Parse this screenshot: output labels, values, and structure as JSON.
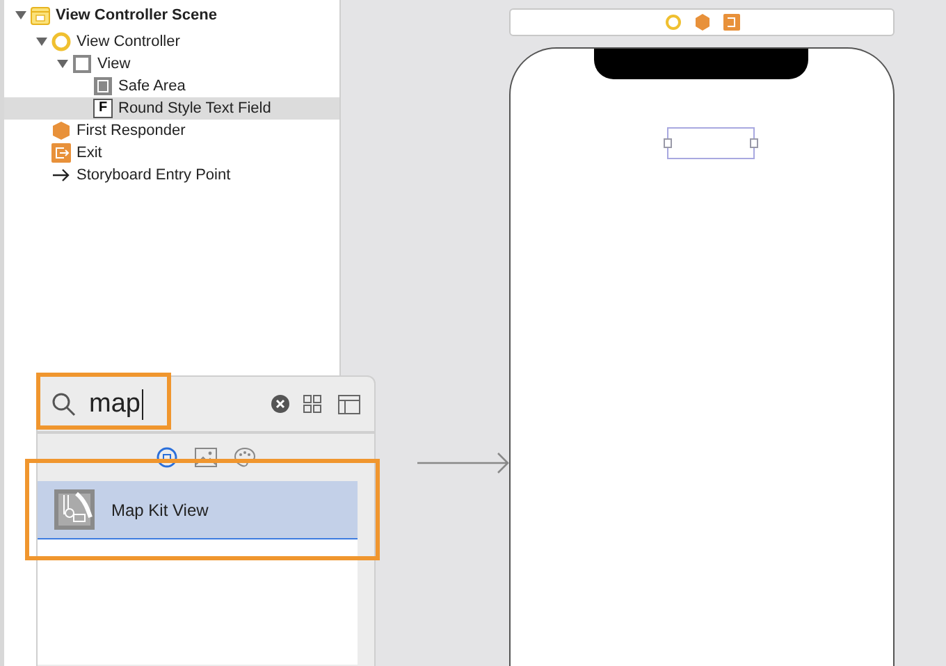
{
  "outline": [
    {
      "label": "View Controller Scene",
      "kind": "scene",
      "expanded": true,
      "selected": false,
      "children": [
        {
          "label": "View Controller",
          "kind": "controller",
          "expanded": true,
          "selected": false,
          "children": [
            {
              "label": "View",
              "kind": "view",
              "expanded": true,
              "selected": false,
              "children": [
                {
                  "label": "Safe Area",
                  "kind": "safe-area",
                  "selected": false
                },
                {
                  "label": "Round Style Text Field",
                  "kind": "text-field",
                  "icon_text": "F",
                  "selected": true
                }
              ]
            }
          ]
        },
        {
          "label": "First Responder",
          "kind": "responder",
          "selected": false
        },
        {
          "label": "Exit",
          "kind": "exit",
          "selected": false
        },
        {
          "label": "Storyboard Entry Point",
          "kind": "entry",
          "selected": false
        }
      ]
    }
  ],
  "library": {
    "search": {
      "value": "map"
    },
    "filter_tabs": [
      {
        "kind": "objects",
        "selected": true
      },
      {
        "kind": "media",
        "selected": false
      },
      {
        "kind": "colors",
        "selected": false
      }
    ],
    "results": [
      {
        "label": "Map Kit View",
        "selected": true
      }
    ]
  }
}
